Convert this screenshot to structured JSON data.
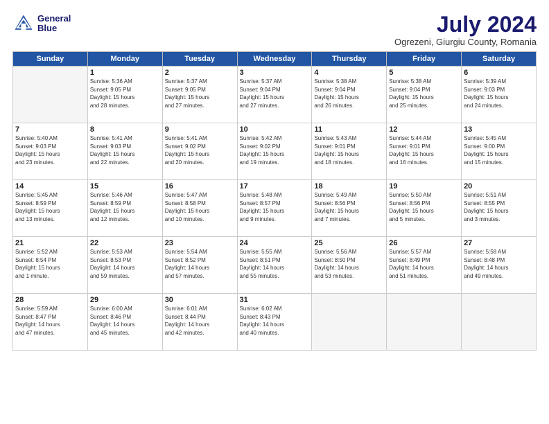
{
  "header": {
    "logo_line1": "General",
    "logo_line2": "Blue",
    "title": "July 2024",
    "subtitle": "Ogrezeni, Giurgiu County, Romania"
  },
  "weekdays": [
    "Sunday",
    "Monday",
    "Tuesday",
    "Wednesday",
    "Thursday",
    "Friday",
    "Saturday"
  ],
  "weeks": [
    [
      {
        "num": "",
        "detail": ""
      },
      {
        "num": "1",
        "detail": "Sunrise: 5:36 AM\nSunset: 9:05 PM\nDaylight: 15 hours\nand 28 minutes."
      },
      {
        "num": "2",
        "detail": "Sunrise: 5:37 AM\nSunset: 9:05 PM\nDaylight: 15 hours\nand 27 minutes."
      },
      {
        "num": "3",
        "detail": "Sunrise: 5:37 AM\nSunset: 9:04 PM\nDaylight: 15 hours\nand 27 minutes."
      },
      {
        "num": "4",
        "detail": "Sunrise: 5:38 AM\nSunset: 9:04 PM\nDaylight: 15 hours\nand 26 minutes."
      },
      {
        "num": "5",
        "detail": "Sunrise: 5:38 AM\nSunset: 9:04 PM\nDaylight: 15 hours\nand 25 minutes."
      },
      {
        "num": "6",
        "detail": "Sunrise: 5:39 AM\nSunset: 9:03 PM\nDaylight: 15 hours\nand 24 minutes."
      }
    ],
    [
      {
        "num": "7",
        "detail": "Sunrise: 5:40 AM\nSunset: 9:03 PM\nDaylight: 15 hours\nand 23 minutes."
      },
      {
        "num": "8",
        "detail": "Sunrise: 5:41 AM\nSunset: 9:03 PM\nDaylight: 15 hours\nand 22 minutes."
      },
      {
        "num": "9",
        "detail": "Sunrise: 5:41 AM\nSunset: 9:02 PM\nDaylight: 15 hours\nand 20 minutes."
      },
      {
        "num": "10",
        "detail": "Sunrise: 5:42 AM\nSunset: 9:02 PM\nDaylight: 15 hours\nand 19 minutes."
      },
      {
        "num": "11",
        "detail": "Sunrise: 5:43 AM\nSunset: 9:01 PM\nDaylight: 15 hours\nand 18 minutes."
      },
      {
        "num": "12",
        "detail": "Sunrise: 5:44 AM\nSunset: 9:01 PM\nDaylight: 15 hours\nand 16 minutes."
      },
      {
        "num": "13",
        "detail": "Sunrise: 5:45 AM\nSunset: 9:00 PM\nDaylight: 15 hours\nand 15 minutes."
      }
    ],
    [
      {
        "num": "14",
        "detail": "Sunrise: 5:45 AM\nSunset: 8:59 PM\nDaylight: 15 hours\nand 13 minutes."
      },
      {
        "num": "15",
        "detail": "Sunrise: 5:46 AM\nSunset: 8:59 PM\nDaylight: 15 hours\nand 12 minutes."
      },
      {
        "num": "16",
        "detail": "Sunrise: 5:47 AM\nSunset: 8:58 PM\nDaylight: 15 hours\nand 10 minutes."
      },
      {
        "num": "17",
        "detail": "Sunrise: 5:48 AM\nSunset: 8:57 PM\nDaylight: 15 hours\nand 9 minutes."
      },
      {
        "num": "18",
        "detail": "Sunrise: 5:49 AM\nSunset: 8:56 PM\nDaylight: 15 hours\nand 7 minutes."
      },
      {
        "num": "19",
        "detail": "Sunrise: 5:50 AM\nSunset: 8:56 PM\nDaylight: 15 hours\nand 5 minutes."
      },
      {
        "num": "20",
        "detail": "Sunrise: 5:51 AM\nSunset: 8:55 PM\nDaylight: 15 hours\nand 3 minutes."
      }
    ],
    [
      {
        "num": "21",
        "detail": "Sunrise: 5:52 AM\nSunset: 8:54 PM\nDaylight: 15 hours\nand 1 minute."
      },
      {
        "num": "22",
        "detail": "Sunrise: 5:53 AM\nSunset: 8:53 PM\nDaylight: 14 hours\nand 59 minutes."
      },
      {
        "num": "23",
        "detail": "Sunrise: 5:54 AM\nSunset: 8:52 PM\nDaylight: 14 hours\nand 57 minutes."
      },
      {
        "num": "24",
        "detail": "Sunrise: 5:55 AM\nSunset: 8:51 PM\nDaylight: 14 hours\nand 55 minutes."
      },
      {
        "num": "25",
        "detail": "Sunrise: 5:56 AM\nSunset: 8:50 PM\nDaylight: 14 hours\nand 53 minutes."
      },
      {
        "num": "26",
        "detail": "Sunrise: 5:57 AM\nSunset: 8:49 PM\nDaylight: 14 hours\nand 51 minutes."
      },
      {
        "num": "27",
        "detail": "Sunrise: 5:58 AM\nSunset: 8:48 PM\nDaylight: 14 hours\nand 49 minutes."
      }
    ],
    [
      {
        "num": "28",
        "detail": "Sunrise: 5:59 AM\nSunset: 8:47 PM\nDaylight: 14 hours\nand 47 minutes."
      },
      {
        "num": "29",
        "detail": "Sunrise: 6:00 AM\nSunset: 8:46 PM\nDaylight: 14 hours\nand 45 minutes."
      },
      {
        "num": "30",
        "detail": "Sunrise: 6:01 AM\nSunset: 8:44 PM\nDaylight: 14 hours\nand 42 minutes."
      },
      {
        "num": "31",
        "detail": "Sunrise: 6:02 AM\nSunset: 8:43 PM\nDaylight: 14 hours\nand 40 minutes."
      },
      {
        "num": "",
        "detail": ""
      },
      {
        "num": "",
        "detail": ""
      },
      {
        "num": "",
        "detail": ""
      }
    ]
  ]
}
